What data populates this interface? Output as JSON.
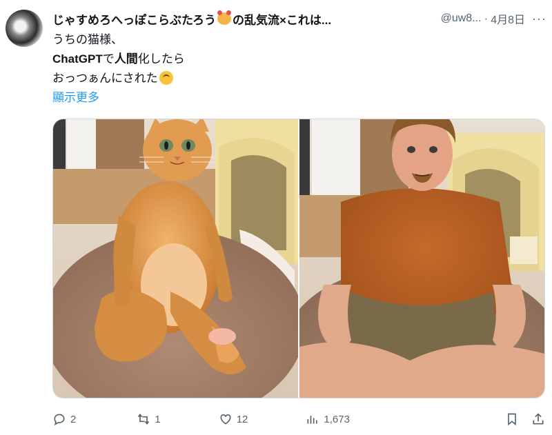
{
  "tweet": {
    "author_name": "じゃすめろへっぽこらぶたろう",
    "author_name_suffix": "の乱気流×これは...",
    "handle": "@uw8...",
    "separator": "·",
    "date": "4月8日",
    "more_icon": "more-horizontal-icon",
    "text": {
      "line1": "うちの猫様、",
      "line2_part1": "ChatGPT",
      "line2_part2": "で",
      "line2_part3": "人間",
      "line2_part4": "化したら",
      "line3": "おっつぁんにされた",
      "show_more": "顯示更多"
    },
    "media": [
      {
        "kind": "photo",
        "subject": "orange tabby cat sitting upright on rug"
      },
      {
        "kind": "photo",
        "subject": "man in orange t-shirt sitting on rug"
      }
    ],
    "actions": {
      "reply_count": "2",
      "retweet_count": "1",
      "like_count": "12",
      "views_count": "1,673"
    }
  },
  "colors": {
    "text": "#0f1419",
    "secondary": "#536471",
    "link": "#1d9bf0",
    "border": "#cfd9de"
  }
}
